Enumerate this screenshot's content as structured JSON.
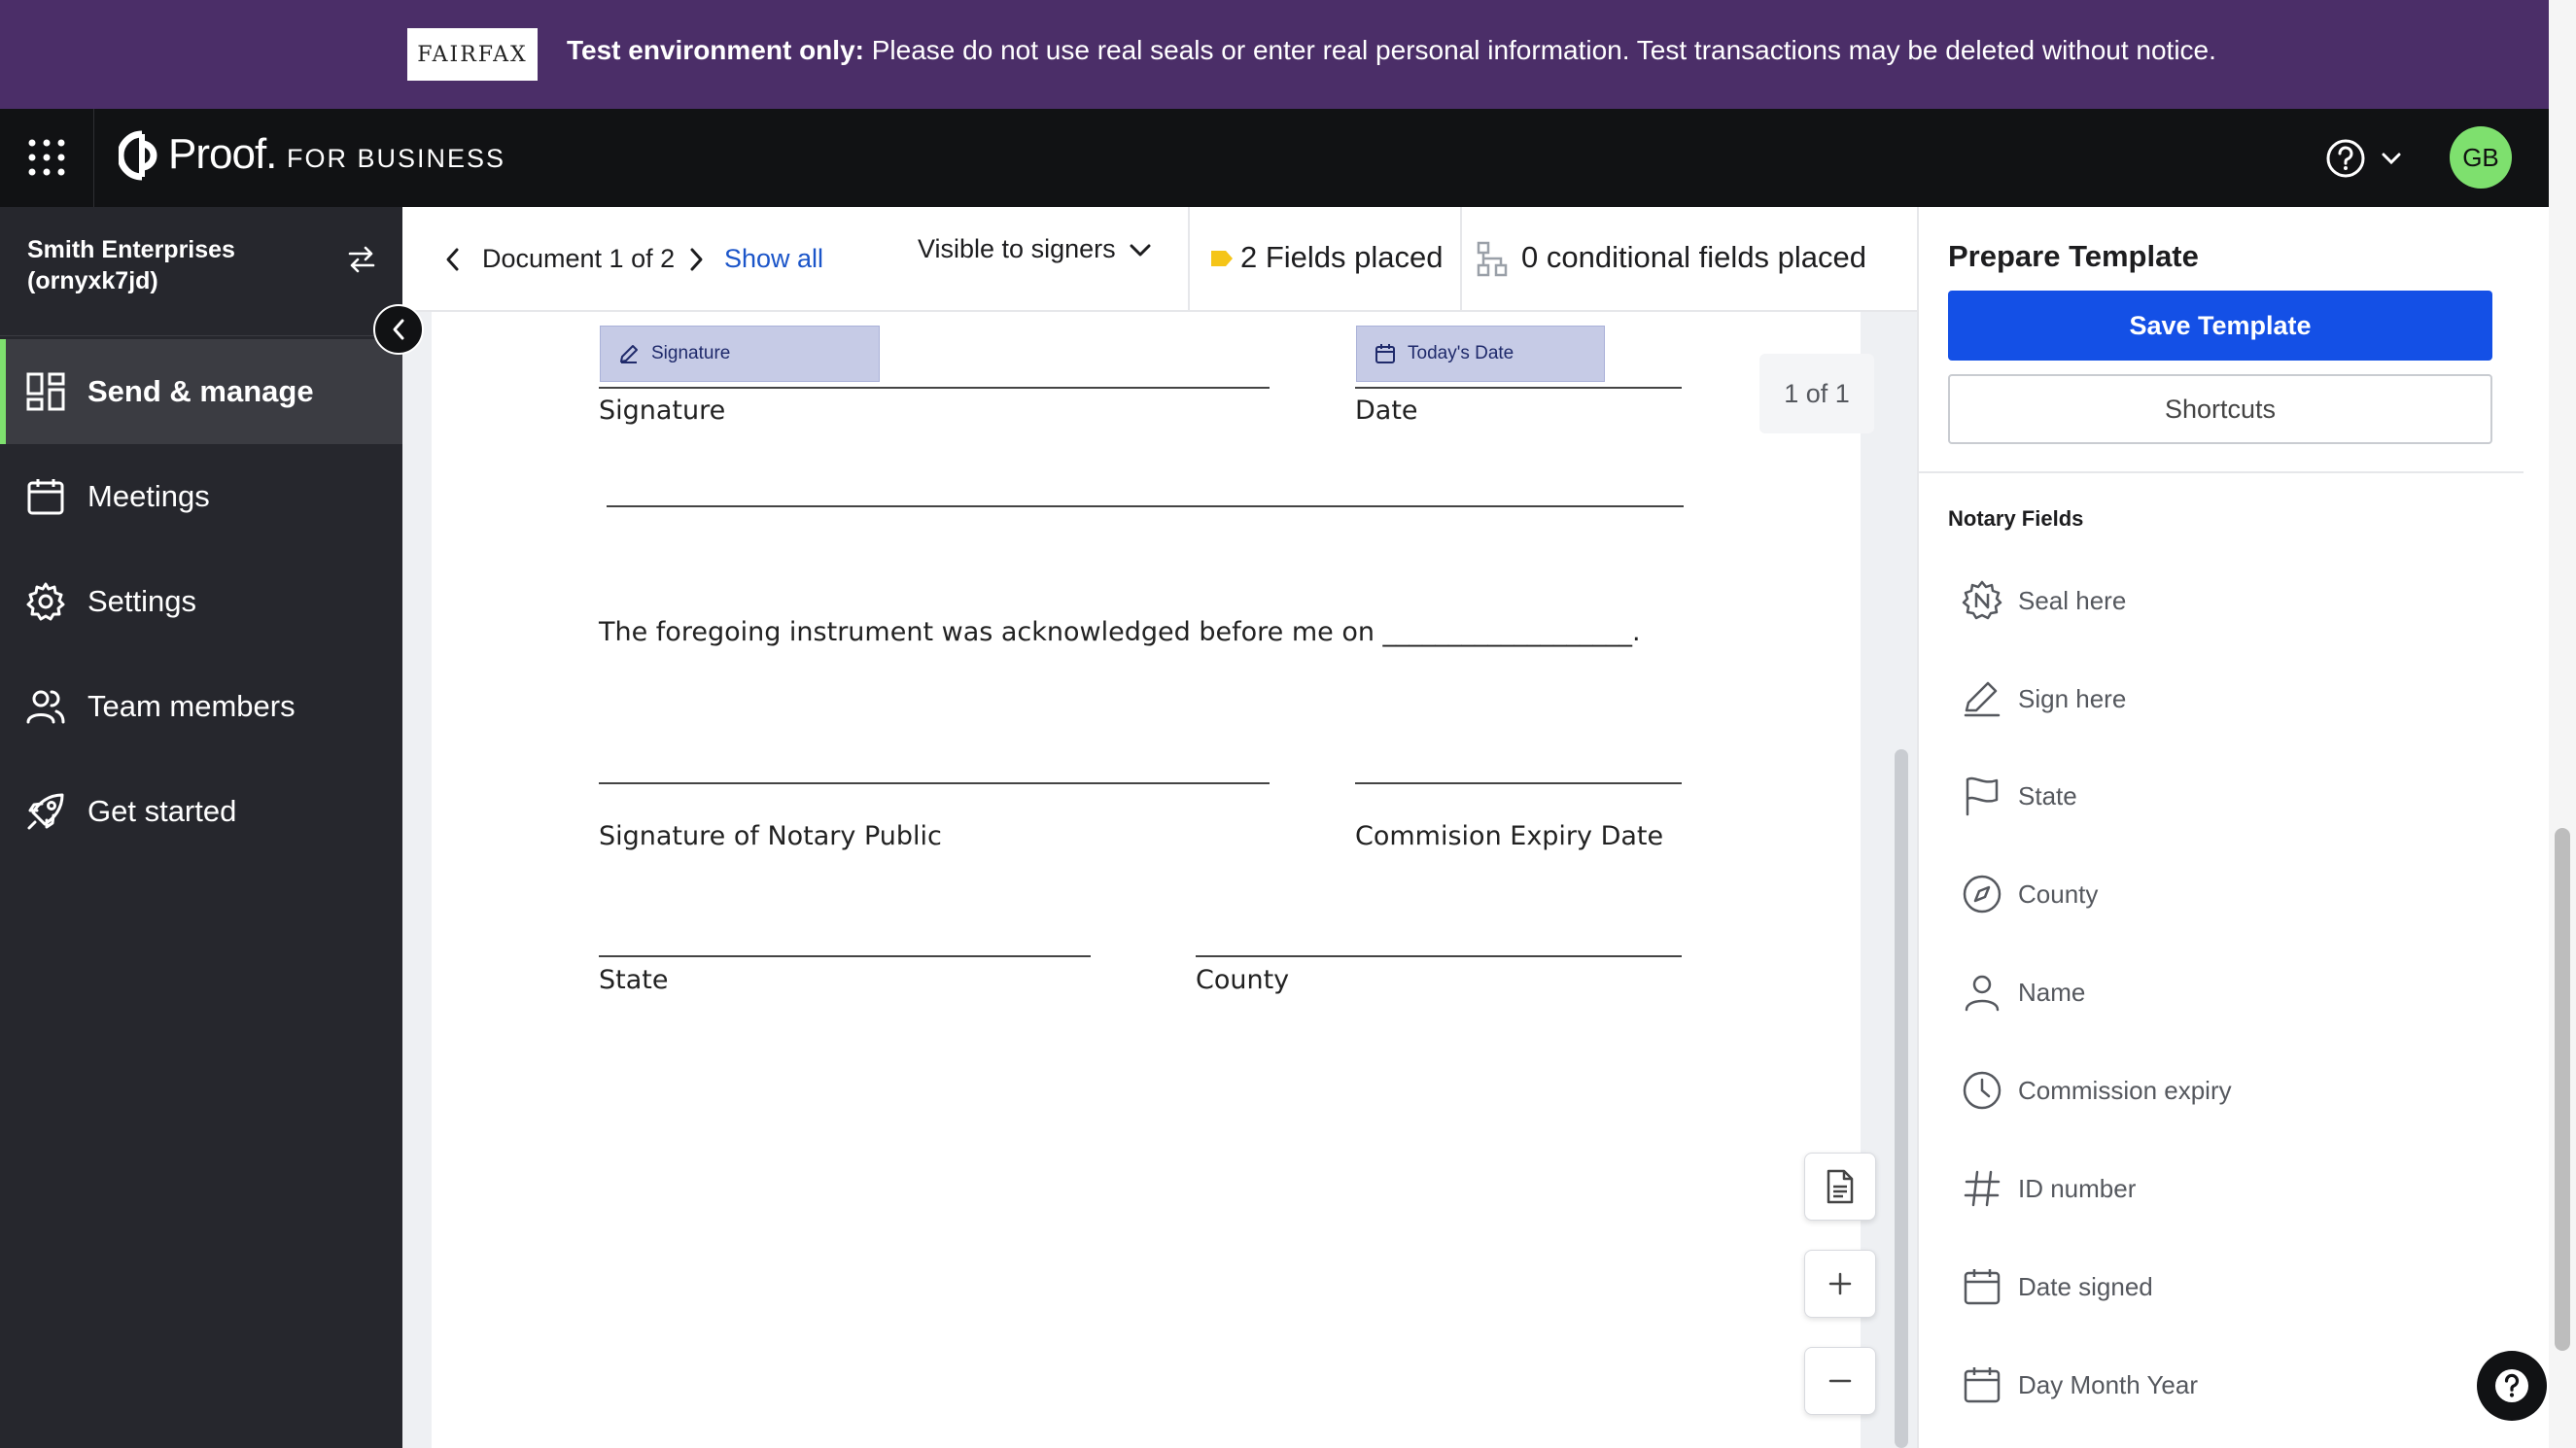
{
  "banner": {
    "badge": "FAIRFAX",
    "bold": "Test environment only:",
    "message": " Please do not use real seals or enter real personal information. Test transactions may be deleted without notice."
  },
  "header": {
    "brand": "Proof.",
    "brand_sub": "FOR BUSINESS",
    "avatar_initials": "GB",
    "icons": [
      "apps-grid-icon",
      "proof-logo-icon",
      "help-circle-icon",
      "chevron-down-icon"
    ]
  },
  "sidebar": {
    "org_name": "Smith Enterprises",
    "org_id": "(ornyxk7jd)",
    "items": [
      {
        "label": "Send & manage",
        "icon": "dashboard-icon",
        "active": true
      },
      {
        "label": "Meetings",
        "icon": "calendar-icon",
        "active": false
      },
      {
        "label": "Settings",
        "icon": "gear-icon",
        "active": false
      },
      {
        "label": "Team members",
        "icon": "users-icon",
        "active": false
      },
      {
        "label": "Get started",
        "icon": "rocket-icon",
        "active": false
      }
    ]
  },
  "toolbar": {
    "document_label": "Document 1 of 2",
    "show_all": "Show all",
    "visibility": "Visible to signers",
    "fields_placed": "2 Fields placed",
    "conditional_fields": "0 conditional fields placed"
  },
  "document": {
    "chip_signature": "Signature",
    "chip_date": "Today's Date",
    "label_signature": "Signature",
    "label_date": "Date",
    "acknowledged": "The foregoing instrument was acknowledged before me on ___________________.",
    "label_notary_signature": "Signature of Notary Public",
    "label_commission_expiry": "Commision Expiry Date",
    "label_state": "State",
    "label_county": "County",
    "page_indicator": "1 of 1"
  },
  "panel": {
    "title": "Prepare Template",
    "save_button": "Save Template",
    "shortcuts_button": "Shortcuts",
    "section_title": "Notary Fields",
    "fields": [
      {
        "label": "Seal here",
        "icon": "seal-icon"
      },
      {
        "label": "Sign here",
        "icon": "pen-icon"
      },
      {
        "label": "State",
        "icon": "flag-icon"
      },
      {
        "label": "County",
        "icon": "compass-icon"
      },
      {
        "label": "Name",
        "icon": "person-icon"
      },
      {
        "label": "Commission expiry",
        "icon": "clock-icon"
      },
      {
        "label": "ID number",
        "icon": "hash-icon"
      },
      {
        "label": "Date signed",
        "icon": "calendar-icon"
      },
      {
        "label": "Day Month Year",
        "icon": "calendar-icon"
      }
    ]
  },
  "colors": {
    "banner_bg": "#4b2e68",
    "header_bg": "#111214",
    "sidebar_bg": "#26272d",
    "accent_green": "#7ee06e",
    "primary_blue": "#1450e6",
    "link_blue": "#1b55c9",
    "field_chip": "#c6cbe6",
    "tag_yellow": "#f5c518"
  }
}
